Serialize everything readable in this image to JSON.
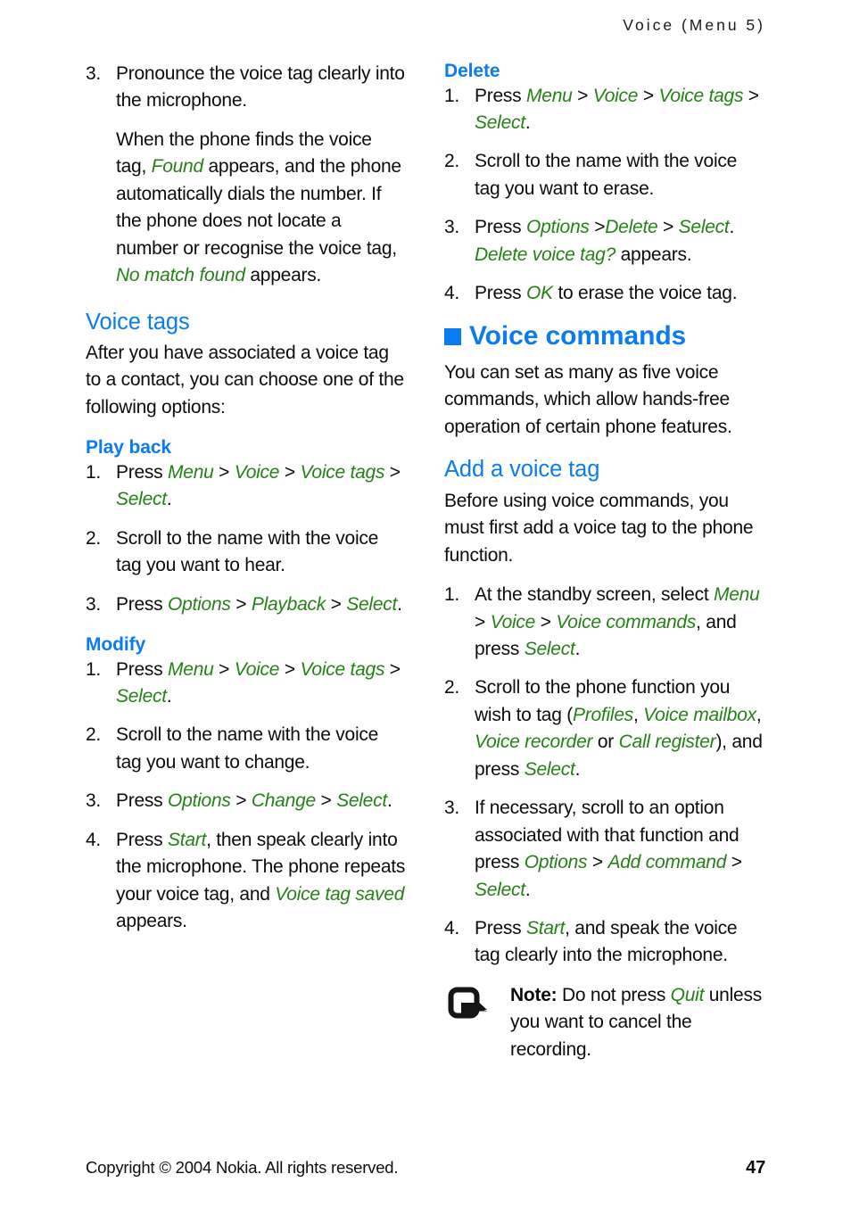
{
  "header": {
    "running_title": "Voice (Menu 5)"
  },
  "left_column": {
    "step3": {
      "number": "3.",
      "line1": "Pronounce the voice tag clearly into the microphone."
    },
    "paragraph_found": {
      "t1": "When the phone finds the voice tag, ",
      "ui1": "Found",
      "t2": " appears, and the phone automatically dials the number. If the phone does not locate a number or recognise the voice tag, ",
      "ui2": "No match found",
      "t3": " appears."
    },
    "voice_tags_heading": "Voice tags",
    "voice_tags_intro": "After you have associated a voice tag to a contact, you can choose one of the following options:",
    "play_back": {
      "heading": "Play back",
      "steps": [
        {
          "number": "1.",
          "pre": "Press ",
          "ui": [
            "Menu",
            "Voice",
            "Voice tags",
            "Select"
          ],
          "post": "."
        },
        {
          "number": "2.",
          "text": "Scroll to the name with the voice tag you want to hear."
        },
        {
          "number": "3.",
          "pre": "Press ",
          "ui": [
            "Options",
            "Playback",
            "Select"
          ],
          "post": "."
        }
      ]
    },
    "modify": {
      "heading": "Modify",
      "steps": [
        {
          "number": "1.",
          "pre": "Press ",
          "ui": [
            "Menu",
            "Voice",
            "Voice tags",
            "Select"
          ],
          "post": "."
        },
        {
          "number": "2.",
          "text": "Scroll to the name with the voice tag you want to change."
        },
        {
          "number": "3.",
          "pre": "Press ",
          "ui": [
            "Options",
            "Change",
            "Select"
          ],
          "post": "."
        },
        {
          "number": "4.",
          "pre": "Press ",
          "ui_start": "Start",
          "mid": ", then speak clearly into the microphone. The phone repeats your voice tag, and ",
          "ui_end": "Voice tag saved",
          "post": " appears."
        }
      ]
    }
  },
  "right_column": {
    "delete": {
      "heading": "Delete",
      "steps": [
        {
          "number": "1.",
          "pre": "Press ",
          "ui": [
            "Menu",
            "Voice",
            "Voice tags",
            "Select"
          ],
          "post": "."
        },
        {
          "number": "2.",
          "text": "Scroll to the name with the voice tag you want to erase."
        },
        {
          "number": "3.",
          "pre": "Press ",
          "ui": [
            "Options",
            "Delete",
            "Select"
          ],
          "post": ". ",
          "ui_msg": "Delete voice tag?",
          "tail": " appears."
        },
        {
          "number": "4.",
          "pre": "Press ",
          "ui_start": "OK",
          "mid": " to erase the voice tag."
        }
      ]
    },
    "voice_commands": {
      "heading": "Voice commands",
      "intro": "You can set as many as five voice commands, which allow hands-free operation of certain phone features."
    },
    "add_a_voice_tag": {
      "heading": "Add a voice tag",
      "intro": "Before using voice commands, you must first add a voice tag to the phone function.",
      "steps": [
        {
          "number": "1.",
          "pre": "At the standby screen, select ",
          "ui": [
            "Menu",
            "Voice",
            "Voice commands"
          ],
          "mid": ", and press ",
          "ui_end": "Select",
          "post": "."
        },
        {
          "number": "2.",
          "pre": "Scroll to the phone function you wish to tag (",
          "ui_list": [
            "Profiles",
            "Voice mailbox",
            "Voice recorder"
          ],
          "or": " or ",
          "ui_last": "Call register",
          "mid": "), and press ",
          "ui_end": "Select",
          "post": "."
        },
        {
          "number": "3.",
          "pre": "If necessary, scroll to an option associated with that function and press ",
          "ui": [
            "Options",
            "Add command",
            "Select"
          ],
          "post": "."
        },
        {
          "number": "4.",
          "pre": "Press ",
          "ui_start": "Start",
          "mid": ", and speak the voice tag clearly into the microphone."
        }
      ]
    },
    "note": {
      "icon": "note-arrow-icon",
      "label": "Note:",
      "text_before": " Do not press ",
      "ui": "Quit",
      "text_after": " unless you want to cancel the recording."
    }
  },
  "footer": {
    "copyright": "Copyright © 2004 Nokia. All rights reserved.",
    "page_number": "47"
  },
  "colors": {
    "heading_blue": "#0b7bf0",
    "ui_green": "#268019",
    "body_black": "#0d0d0d"
  }
}
